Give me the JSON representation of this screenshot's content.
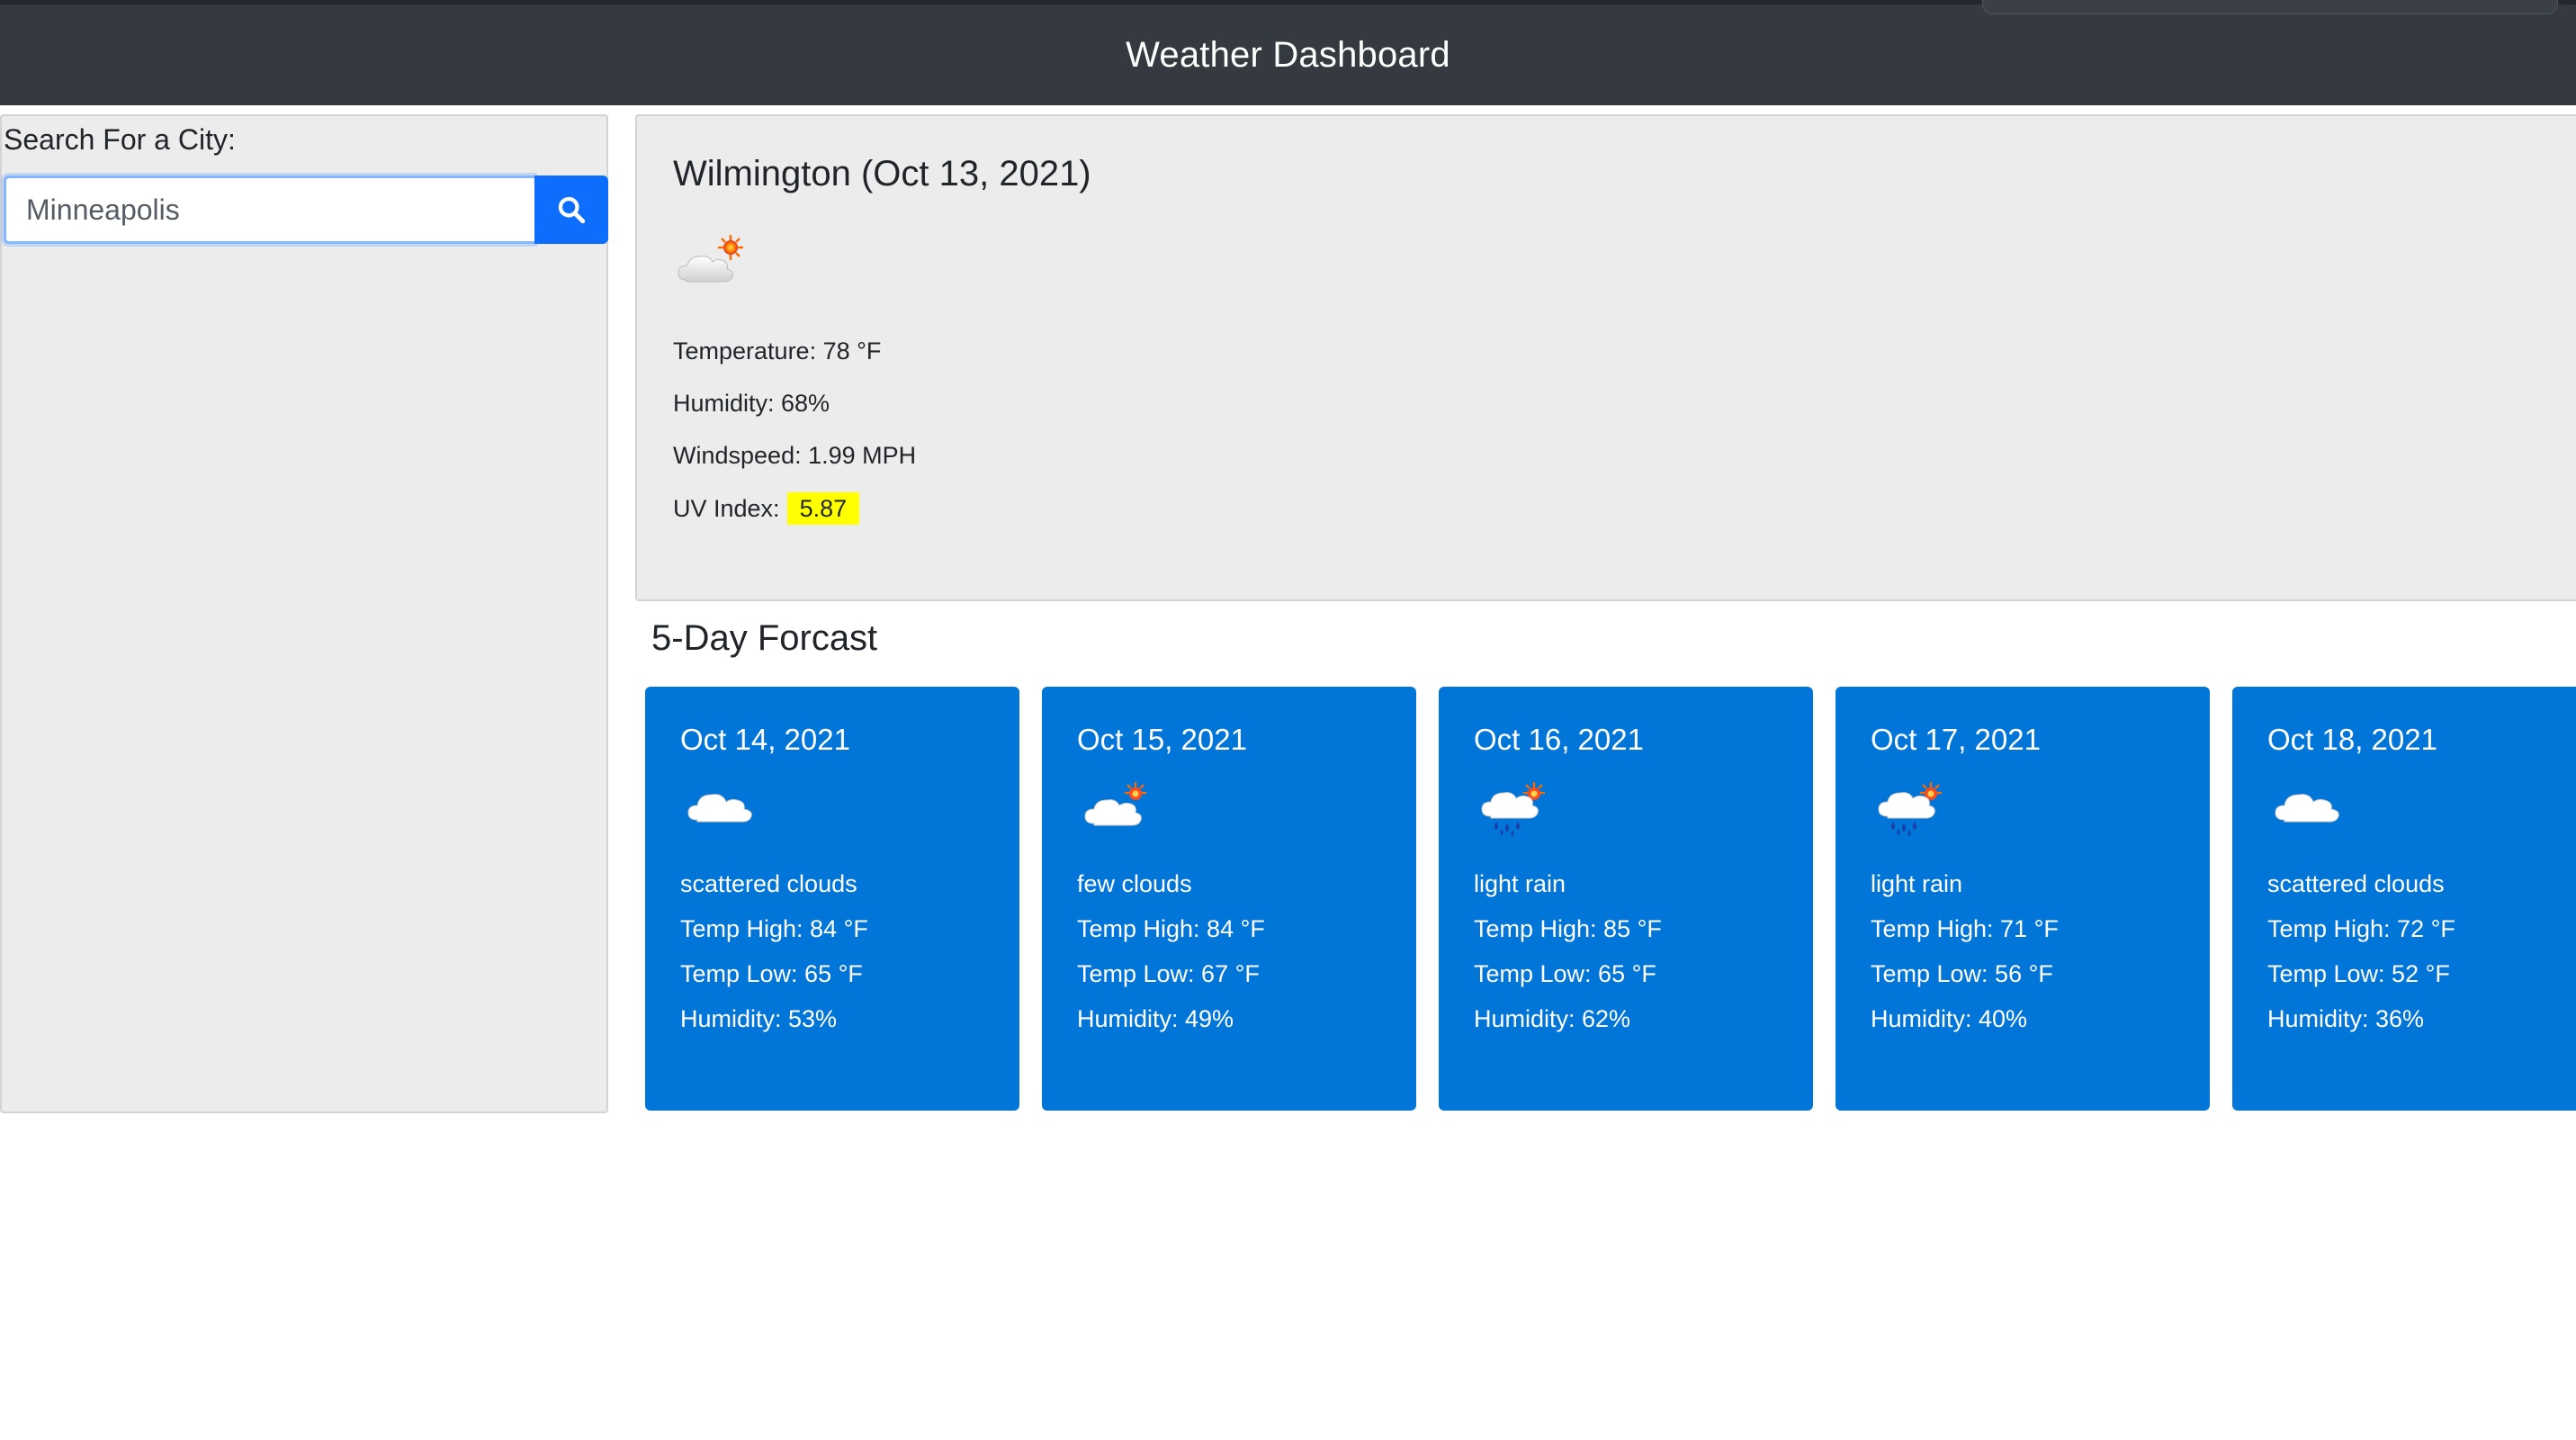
{
  "header": {
    "title": "Weather Dashboard"
  },
  "search": {
    "label": "Search For a City:",
    "value": "Minneapolis",
    "button_icon": "search-icon"
  },
  "current": {
    "title": "Wilmington (Oct 13, 2021)",
    "icon": "few-clouds-day-icon",
    "temperature": "Temperature: 78 °F",
    "humidity": "Humidity: 68%",
    "windspeed": "Windspeed: 1.99 MPH",
    "uv_label": "UV Index:",
    "uv_value": "5.87",
    "uv_color": "#ffff00"
  },
  "forecast": {
    "heading": "5-Day Forcast",
    "card_color": "#0275d8",
    "days": [
      {
        "date": "Oct 14, 2021",
        "icon": "scattered-clouds-icon",
        "desc": "scattered clouds",
        "high": "Temp High: 84 °F",
        "low": "Temp Low: 65 °F",
        "humidity": "Humidity: 53%"
      },
      {
        "date": "Oct 15, 2021",
        "icon": "few-clouds-day-icon",
        "desc": "few clouds",
        "high": "Temp High: 84 °F",
        "low": "Temp Low: 67 °F",
        "humidity": "Humidity: 49%"
      },
      {
        "date": "Oct 16, 2021",
        "icon": "light-rain-day-icon",
        "desc": "light rain",
        "high": "Temp High: 85 °F",
        "low": "Temp Low: 65 °F",
        "humidity": "Humidity: 62%"
      },
      {
        "date": "Oct 17, 2021",
        "icon": "light-rain-day-icon",
        "desc": "light rain",
        "high": "Temp High: 71 °F",
        "low": "Temp Low: 56 °F",
        "humidity": "Humidity: 40%"
      },
      {
        "date": "Oct 18, 2021",
        "icon": "scattered-clouds-icon",
        "desc": "scattered clouds",
        "high": "Temp High: 72 °F",
        "low": "Temp Low: 52 °F",
        "humidity": "Humidity: 36%"
      }
    ]
  }
}
